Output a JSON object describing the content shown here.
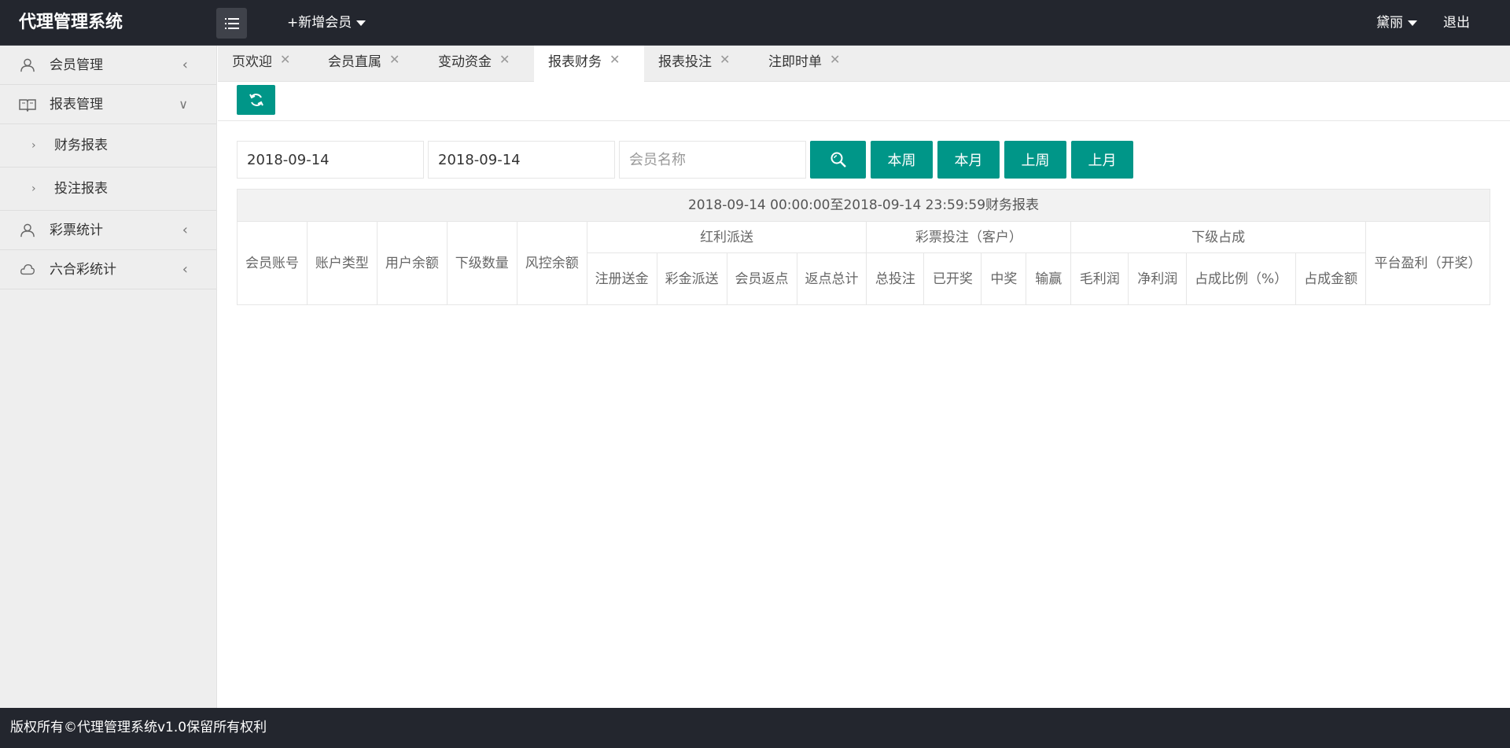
{
  "header": {
    "logo": "代理管理系统",
    "add_member": "+新增会员",
    "user_name": "黛丽",
    "logout": "退出"
  },
  "sidebar": {
    "items": [
      {
        "label": "会员管理",
        "icon": "user-icon",
        "arrow": "<"
      },
      {
        "label": "报表管理",
        "icon": "book-icon",
        "arrow": "v"
      },
      {
        "label": "彩票统计",
        "icon": "user-icon",
        "arrow": "<"
      },
      {
        "label": "六合彩统计",
        "icon": "cloud-icon",
        "arrow": "<"
      }
    ],
    "sub_items": [
      {
        "label": "财务报表"
      },
      {
        "label": "投注报表"
      }
    ]
  },
  "tabs": [
    {
      "label": "页欢迎",
      "active": false
    },
    {
      "label": "会员直属",
      "active": false
    },
    {
      "label": "变动资金",
      "active": false
    },
    {
      "label": "报表财务",
      "active": true
    },
    {
      "label": "报表投注",
      "active": false
    },
    {
      "label": "注即时单",
      "active": false
    }
  ],
  "search": {
    "start_date": "2018-09-14",
    "end_date": "2018-09-14",
    "member_placeholder": "会员名称",
    "btn_this_week": "本周",
    "btn_this_month": "本月",
    "btn_last_week": "上周",
    "btn_last_month": "上月"
  },
  "table": {
    "caption": "2018-09-14 00:00:00至2018-09-14 23:59:59财务报表",
    "col_member_account": "会员账号",
    "col_account_type": "账户类型",
    "col_user_balance": "用户余额",
    "col_sub_count": "下级数量",
    "col_risk_balance": "风控余额",
    "group_bonus": "红利派送",
    "group_lottery": "彩票投注（客户）",
    "group_share": "下级占成",
    "col_platform_profit": "平台盈利（开奖）",
    "bonus_cols": [
      "注册送金",
      "彩金派送",
      "会员返点",
      "返点总计"
    ],
    "lottery_cols": [
      "总投注",
      "已开奖",
      "中奖",
      "输赢"
    ],
    "share_cols": [
      "毛利润",
      "净利润",
      "占成比例（%）",
      "占成金额"
    ]
  },
  "footer": {
    "copyright": "版权所有©代理管理系统v1.0保留所有权利"
  },
  "colors": {
    "accent": "#009688",
    "header_bg": "#23262e",
    "sidebar_bg": "#eeeeee"
  }
}
